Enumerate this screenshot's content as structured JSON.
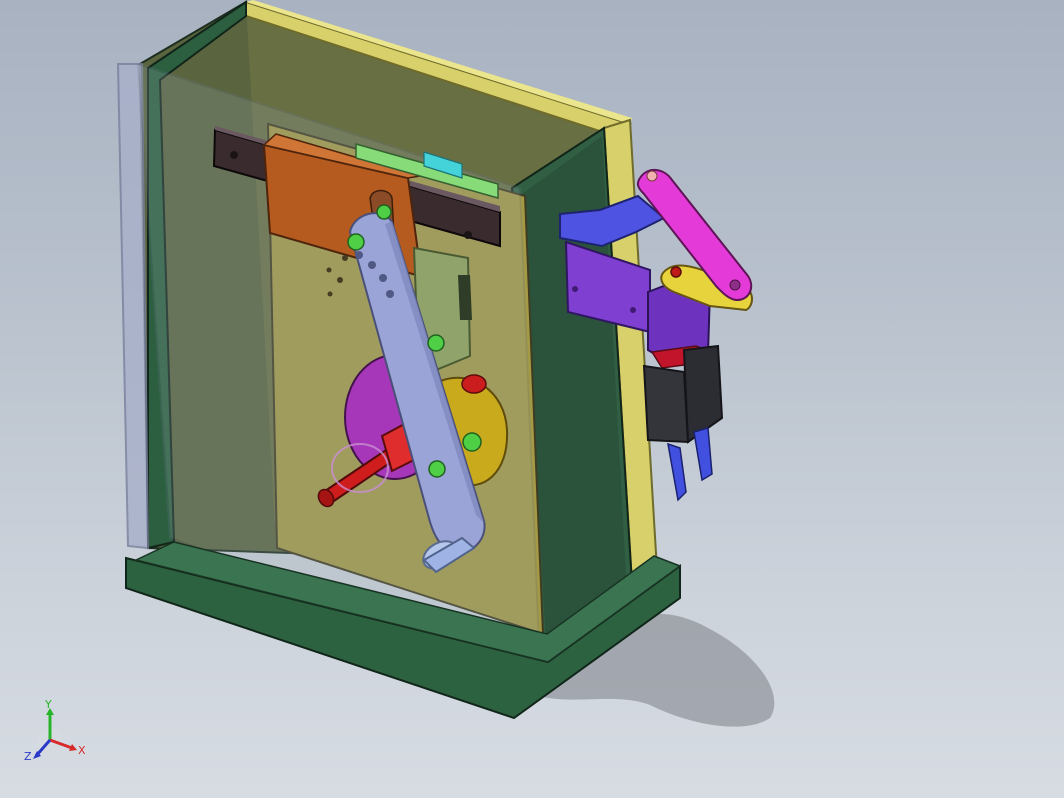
{
  "viewport": {
    "background_top": "#a8b2c1",
    "background_bottom": "#d7dce3"
  },
  "model": {
    "colors": {
      "frame_green": "#2c5f3f",
      "frame_dark": "#21452e",
      "top_plate": "#d8d06a",
      "side_glass": "#9aa6c6",
      "slider_brown": "#b55b1f",
      "guide_rail": "#3a2b2e",
      "lavender_link": "#9aa4d6",
      "cam_magenta": "#a637b8",
      "cam_yellow": "#c9aa1c",
      "shaft_red": "#cf1c1c",
      "pin_green": "#4fcf46",
      "gripper_purple": "#7f3fd0",
      "gripper_blue": "#4f53e2",
      "arm_pink": "#e33ad8",
      "arm_yellow": "#e7d33c",
      "finger_block": "#34353b"
    }
  },
  "triad": {
    "y_label": "Y",
    "x_label": "X",
    "z_label": "Z",
    "x_color": "#d72b2b",
    "y_color": "#28b428",
    "z_color": "#2a38c9"
  }
}
